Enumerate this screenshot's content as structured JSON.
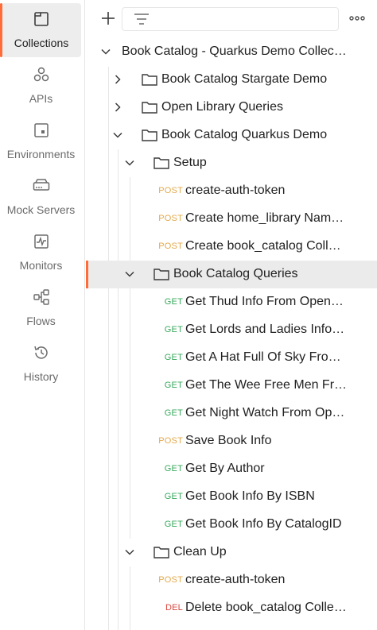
{
  "rail": [
    {
      "label": "Collections",
      "icon": "collections-icon",
      "active": true
    },
    {
      "label": "APIs",
      "icon": "apis-icon"
    },
    {
      "label": "Environments",
      "icon": "environments-icon"
    },
    {
      "label": "Mock Servers",
      "icon": "mock-servers-icon"
    },
    {
      "label": "Monitors",
      "icon": "monitors-icon"
    },
    {
      "label": "Flows",
      "icon": "flows-icon"
    },
    {
      "label": "History",
      "icon": "history-icon"
    }
  ],
  "tree": {
    "collection": "Book Catalog - Quarkus Demo Collec…",
    "folders": [
      {
        "label": "Book Catalog Stargate Demo",
        "expanded": false
      },
      {
        "label": "Open Library Queries",
        "expanded": false
      },
      {
        "label": "Book Catalog Quarkus Demo",
        "expanded": true
      }
    ],
    "setup": {
      "label": "Setup",
      "requests": [
        {
          "method": "POST",
          "label": "create-auth-token"
        },
        {
          "method": "POST",
          "label": "Create home_library Nam…"
        },
        {
          "method": "POST",
          "label": "Create book_catalog Coll…"
        }
      ]
    },
    "queries": {
      "label": "Book Catalog Queries",
      "requests": [
        {
          "method": "GET",
          "label": "Get Thud Info From Open…"
        },
        {
          "method": "GET",
          "label": "Get Lords and Ladies Info…"
        },
        {
          "method": "GET",
          "label": "Get A Hat Full Of Sky Fro…"
        },
        {
          "method": "GET",
          "label": "Get The Wee Free Men Fr…"
        },
        {
          "method": "GET",
          "label": "Get Night Watch From Op…"
        },
        {
          "method": "POST",
          "label": "Save Book Info"
        },
        {
          "method": "GET",
          "label": "Get By Author"
        },
        {
          "method": "GET",
          "label": "Get Book Info By ISBN"
        },
        {
          "method": "GET",
          "label": "Get Book Info By CatalogID"
        }
      ]
    },
    "cleanup": {
      "label": "Clean Up",
      "requests": [
        {
          "method": "POST",
          "label": "create-auth-token"
        },
        {
          "method": "DEL",
          "label": "Delete book_catalog Colle…"
        }
      ]
    }
  },
  "colors": {
    "accent": "#ff6c37",
    "post": "#e4a94b",
    "get": "#38a95c",
    "del": "#d9463c"
  }
}
